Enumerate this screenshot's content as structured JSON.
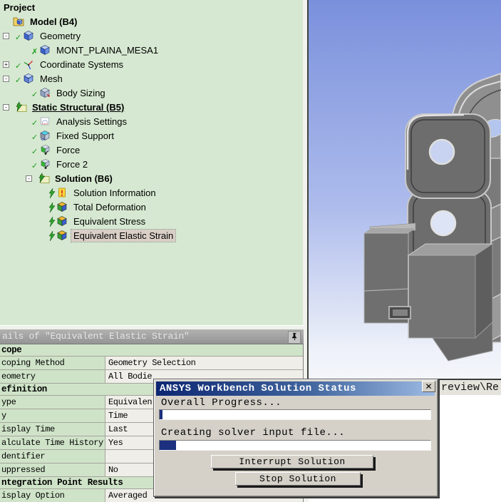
{
  "colors": {
    "tree_bg": "#d6e8d1",
    "selection_bg": "#d9cfc6",
    "detail_label_bg": "#cfe3c8",
    "detail_value_bg": "#efeee8",
    "titlebar_left": "#0c2672",
    "titlebar_right": "#9dbbe4",
    "progress_fill": "#1c307f",
    "viewport_top": "#7a90dc",
    "viewport_bottom": "#f4f6fb",
    "part_gray": "#6d6d6d"
  },
  "outline": {
    "items": [
      {
        "label": "Project",
        "level": 0,
        "bold": true
      },
      {
        "label": "Model (B4)",
        "level": 1,
        "bold": true,
        "icon": "model-folder"
      },
      {
        "label": "Geometry",
        "level": 2,
        "expander": "minus",
        "mark": "check",
        "icon": "geometry-cube"
      },
      {
        "label": "MONT_PLAINA_MESA1",
        "level": 3,
        "mark": "xmark",
        "icon": "geometry-cube"
      },
      {
        "label": "Coordinate Systems",
        "level": 2,
        "expander": "plus",
        "mark": "check",
        "icon": "axes"
      },
      {
        "label": "Mesh",
        "level": 2,
        "expander": "minus",
        "mark": "check",
        "icon": "mesh-cube"
      },
      {
        "label": "Body Sizing",
        "level": 3,
        "mark": "check",
        "icon": "sizing-cube"
      },
      {
        "label": "Static Structural (B5)",
        "level": 2,
        "expander": "minus",
        "bold": true,
        "underline": true,
        "icon": "env-folder"
      },
      {
        "label": "Analysis Settings",
        "level": 3,
        "mark": "check",
        "icon": "analysis-settings"
      },
      {
        "label": "Fixed Support",
        "level": 3,
        "mark": "check",
        "icon": "fixed-support"
      },
      {
        "label": "Force",
        "level": 3,
        "mark": "check",
        "icon": "force"
      },
      {
        "label": "Force 2",
        "level": 3,
        "mark": "check",
        "icon": "force"
      },
      {
        "label": "Solution (B6)",
        "level": 3,
        "expander": "minus",
        "bold": true,
        "icon": "solution-folder"
      },
      {
        "label": "Solution Information",
        "level": 4,
        "mark": "bolt",
        "icon": "solution-info"
      },
      {
        "label": "Total Deformation",
        "level": 4,
        "mark": "bolt",
        "icon": "result-cube"
      },
      {
        "label": "Equivalent Stress",
        "level": 4,
        "mark": "bolt",
        "icon": "result-cube"
      },
      {
        "label": "Equivalent Elastic Strain",
        "level": 4,
        "mark": "bolt",
        "icon": "result-cube",
        "selected": true
      }
    ]
  },
  "details": {
    "header": "ails of \"Equivalent Elastic Strain\"",
    "pin_icon": "pin-icon",
    "rows": [
      {
        "type": "category",
        "label": "cope"
      },
      {
        "type": "row",
        "label": "coping Method",
        "value": "Geometry Selection"
      },
      {
        "type": "row",
        "label": "eometry",
        "value": "All Bodie"
      },
      {
        "type": "category",
        "label": "efinition"
      },
      {
        "type": "row",
        "label": "ype",
        "value": "Equivalen"
      },
      {
        "type": "row",
        "label": "y",
        "value": "Time"
      },
      {
        "type": "row",
        "label": "isplay Time",
        "value": "Last"
      },
      {
        "type": "row",
        "label": "alculate Time History",
        "value": "Yes"
      },
      {
        "type": "row",
        "label": "dentifier",
        "value": ""
      },
      {
        "type": "row",
        "label": "uppressed",
        "value": "No"
      },
      {
        "type": "category",
        "label": "ntegration Point Results"
      },
      {
        "type": "row",
        "label": "isplay Option",
        "value": "Averaged"
      }
    ]
  },
  "solution_dialog": {
    "title": "ANSYS Workbench Solution Status",
    "close_glyph": "✕",
    "overall_label": "Overall Progress...",
    "overall_percent": 1,
    "task_label": "Creating solver input file...",
    "task_percent": 6,
    "interrupt_button": "Interrupt Solution",
    "stop_button": "Stop Solution"
  },
  "graphics": {
    "tab_text": "review\\Re"
  }
}
